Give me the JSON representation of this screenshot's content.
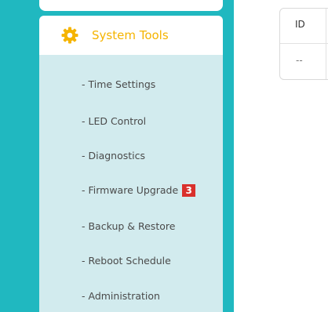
{
  "menu": {
    "header": {
      "icon": "gear-icon",
      "label": "System Tools"
    },
    "items": [
      {
        "label": "- Time Settings"
      },
      {
        "label": "- LED Control"
      },
      {
        "label": "- Diagnostics"
      },
      {
        "label": "- Firmware Upgrade",
        "badge": "3"
      },
      {
        "label": "- Backup & Restore"
      },
      {
        "label": "- Reboot Schedule"
      },
      {
        "label": "- Administration"
      }
    ]
  },
  "table": {
    "headers": [
      "ID"
    ],
    "rows": [
      [
        "--"
      ]
    ]
  },
  "colors": {
    "teal_panel": "#20b8c0",
    "submenu_bg": "#d2ebee",
    "accent_yellow": "#f5b400",
    "badge_red": "#d9302c"
  }
}
